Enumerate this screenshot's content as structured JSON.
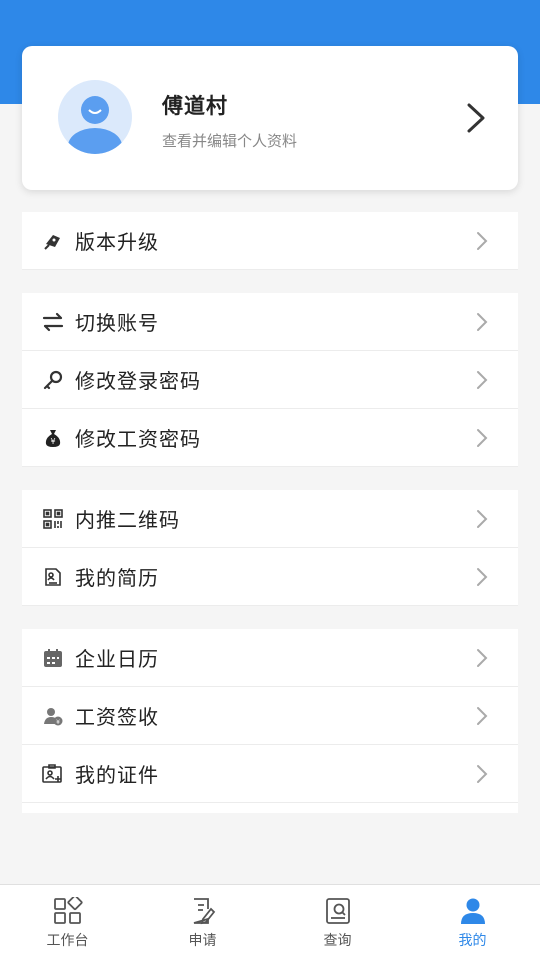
{
  "profile": {
    "name": "傅道村",
    "subtitle": "查看并编辑个人资料"
  },
  "menu_groups": [
    {
      "items": [
        {
          "label": "版本升级",
          "icon": "rocket-icon"
        }
      ]
    },
    {
      "items": [
        {
          "label": "切换账号",
          "icon": "swap-icon"
        },
        {
          "label": "修改登录密码",
          "icon": "key-icon"
        },
        {
          "label": "修改工资密码",
          "icon": "money-bag-icon"
        }
      ]
    },
    {
      "items": [
        {
          "label": "内推二维码",
          "icon": "qrcode-icon"
        },
        {
          "label": "我的简历",
          "icon": "resume-icon"
        }
      ]
    },
    {
      "items": [
        {
          "label": "企业日历",
          "icon": "calendar-icon"
        },
        {
          "label": "工资签收",
          "icon": "salary-receipt-icon"
        },
        {
          "label": "我的证件",
          "icon": "id-card-icon"
        }
      ]
    }
  ],
  "tabbar": [
    {
      "label": "工作台",
      "icon": "grid-icon",
      "active": false
    },
    {
      "label": "申请",
      "icon": "edit-document-icon",
      "active": false
    },
    {
      "label": "查询",
      "icon": "search-document-icon",
      "active": false
    },
    {
      "label": "我的",
      "icon": "user-icon",
      "active": true
    }
  ],
  "colors": {
    "primary": "#2e88e8",
    "background": "#f5f5f5"
  }
}
